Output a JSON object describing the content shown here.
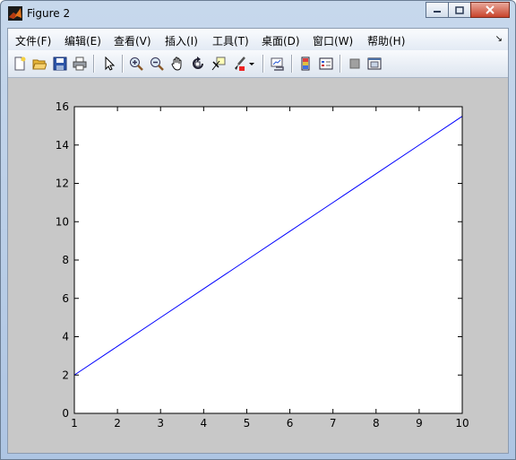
{
  "window": {
    "title": "Figure 2"
  },
  "menu": {
    "items": [
      "文件(F)",
      "编辑(E)",
      "查看(V)",
      "插入(I)",
      "工具(T)",
      "桌面(D)",
      "窗口(W)",
      "帮助(H)"
    ]
  },
  "toolbar": {
    "buttons": [
      "new-figure",
      "open-file",
      "save",
      "print",
      "edit-plot",
      "zoom-in",
      "zoom-out",
      "pan",
      "rotate-3d",
      "data-cursor",
      "brush",
      "link-plot",
      "insert-colorbar",
      "insert-legend",
      "hide-plot-tools",
      "show-plot-tools"
    ]
  },
  "chart_data": {
    "type": "line",
    "x": [
      1,
      2,
      3,
      4,
      5,
      6,
      7,
      8,
      9,
      10
    ],
    "series": [
      {
        "values": [
          2.0,
          3.5,
          5.0,
          6.5,
          8.0,
          9.5,
          11.0,
          12.5,
          14.0,
          15.5
        ],
        "color": "#0000ff"
      }
    ],
    "xlim": [
      1,
      10
    ],
    "ylim": [
      0,
      16
    ],
    "xticks": [
      "1",
      "2",
      "3",
      "4",
      "5",
      "6",
      "7",
      "8",
      "9",
      "10"
    ],
    "yticks": [
      "0",
      "2",
      "4",
      "6",
      "8",
      "10",
      "12",
      "14",
      "16"
    ],
    "grid": false
  }
}
